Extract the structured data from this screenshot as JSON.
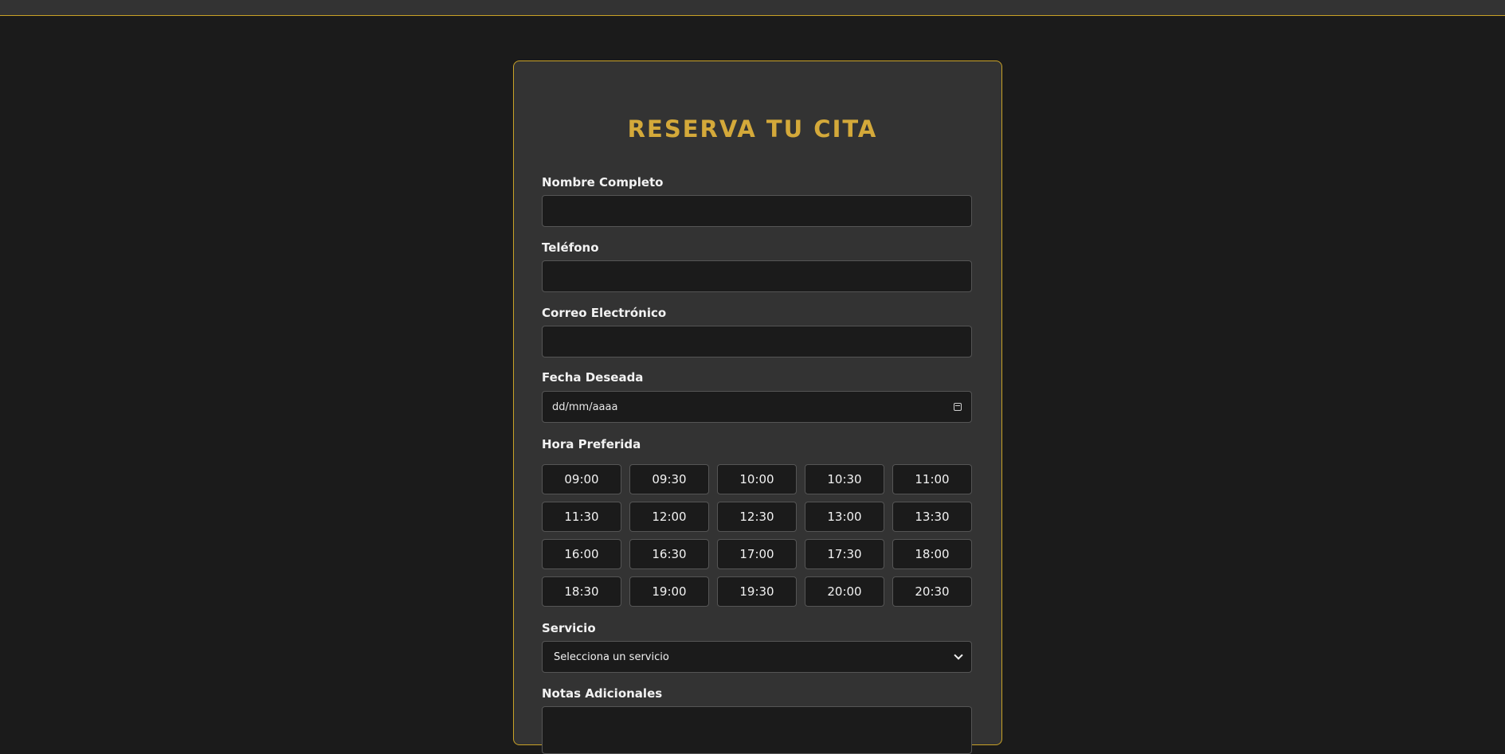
{
  "form": {
    "title": "RESERVA TU CITA",
    "fields": {
      "name": {
        "label": "Nombre Completo",
        "value": ""
      },
      "phone": {
        "label": "Teléfono",
        "value": ""
      },
      "email": {
        "label": "Correo Electrónico",
        "value": ""
      },
      "date": {
        "label": "Fecha Deseada",
        "placeholder": "dd/mm/aaaa"
      },
      "time": {
        "label": "Hora Preferida"
      },
      "service": {
        "label": "Servicio",
        "selected": "Selecciona un servicio"
      },
      "notes": {
        "label": "Notas Adicionales",
        "value": ""
      }
    },
    "time_slots": [
      "09:00",
      "09:30",
      "10:00",
      "10:30",
      "11:00",
      "11:30",
      "12:00",
      "12:30",
      "13:00",
      "13:30",
      "16:00",
      "16:30",
      "17:00",
      "17:30",
      "18:00",
      "18:30",
      "19:00",
      "19:30",
      "20:00",
      "20:30"
    ]
  },
  "colors": {
    "accent": "#d4a93a",
    "border_accent": "#c9a227",
    "background": "#1b1b1b",
    "card": "#333333"
  },
  "icons": {
    "date": "calendar-icon",
    "select": "chevron-down-icon"
  }
}
